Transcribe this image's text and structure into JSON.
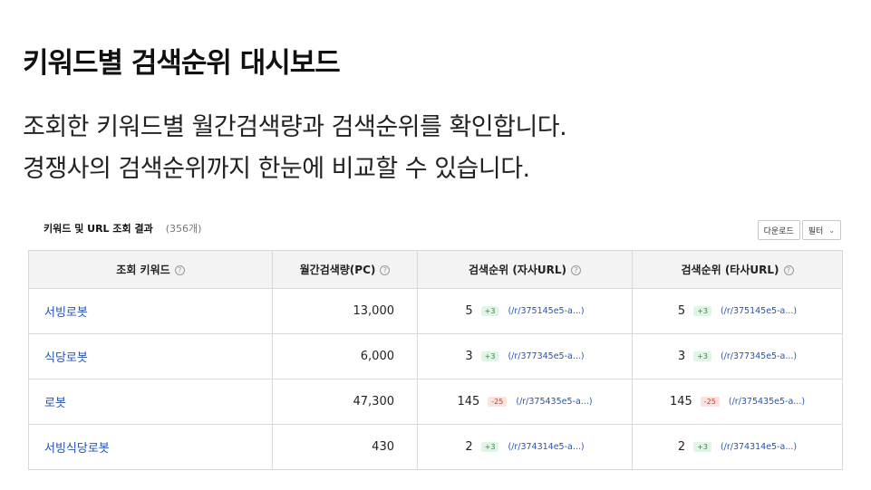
{
  "hero": {
    "title": "키워드별 검색순위 대시보드",
    "desc_line1": "조회한 키워드별 월간검색량과 검색순위를 확인합니다.",
    "desc_line2": "경쟁사의 검색순위까지 한눈에 비교할 수 있습니다."
  },
  "table_header": {
    "title": "키워드 및 URL 조회 결과",
    "count": "(356개)"
  },
  "toolbar": {
    "download_label": "다운로드",
    "filter_label": "필터"
  },
  "columns": {
    "keyword": "조회 키워드",
    "volume": "월간검색량(PC)",
    "own_rank": "검색순위 (자사URL)",
    "competitor_rank": "검색순위 (타사URL)"
  },
  "colors": {
    "link": "#2453b8",
    "delta_up": "#2e8b47",
    "delta_down": "#c53a2f"
  },
  "rows": [
    {
      "keyword": "서빙로봇",
      "volume": "13,000",
      "own": {
        "rank": "5",
        "delta": "+3",
        "url": "(/r/375145e5-a...)"
      },
      "competitor": {
        "rank": "5",
        "delta": "+3",
        "url": "(/r/375145e5-a...)"
      }
    },
    {
      "keyword": "식당로봇",
      "volume": "6,000",
      "own": {
        "rank": "3",
        "delta": "+3",
        "url": "(/r/377345e5-a...)"
      },
      "competitor": {
        "rank": "3",
        "delta": "+3",
        "url": "(/r/377345e5-a...)"
      }
    },
    {
      "keyword": "로봇",
      "volume": "47,300",
      "own": {
        "rank": "145",
        "delta": "-25",
        "url": "(/r/375435e5-a...)"
      },
      "competitor": {
        "rank": "145",
        "delta": "-25",
        "url": "(/r/375435e5-a...)"
      }
    },
    {
      "keyword": "서빙식당로봇",
      "volume": "430",
      "own": {
        "rank": "2",
        "delta": "+3",
        "url": "(/r/374314e5-a...)"
      },
      "competitor": {
        "rank": "2",
        "delta": "+3",
        "url": "(/r/374314e5-a...)"
      }
    }
  ]
}
